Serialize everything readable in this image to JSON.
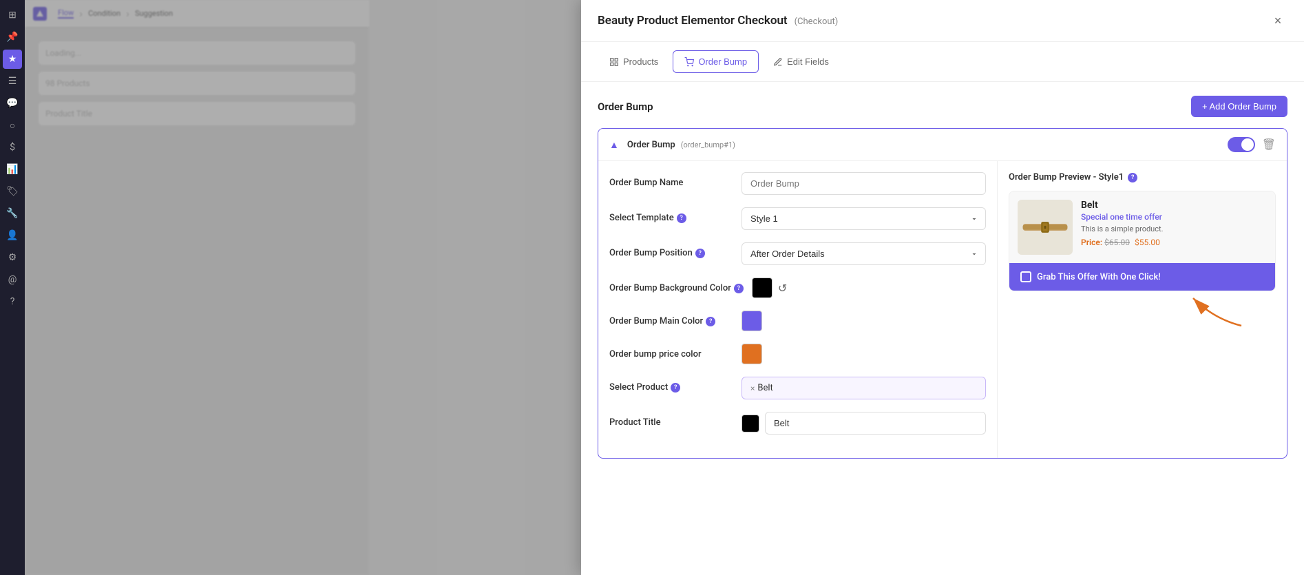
{
  "sidebar": {
    "icons": [
      "grid",
      "pin",
      "star",
      "list",
      "chat",
      "circle",
      "dollar",
      "chart",
      "tag",
      "wrench",
      "user",
      "settings",
      "at",
      "help"
    ]
  },
  "background": {
    "breadcrumbs": [
      "Flow",
      "Condition",
      "Suggestion"
    ],
    "active_crumb": "Flow"
  },
  "modal": {
    "title": "Beauty Product Elementor Checkout",
    "subtitle": "(Checkout)",
    "close_label": "×",
    "tabs": [
      {
        "id": "products",
        "label": "Products",
        "icon": "grid"
      },
      {
        "id": "order_bump",
        "label": "Order Bump",
        "icon": "cart",
        "active": true
      },
      {
        "id": "edit_fields",
        "label": "Edit Fields",
        "icon": "pencil"
      }
    ],
    "section": {
      "title": "Order Bump",
      "add_button": "+ Add Order Bump"
    },
    "order_bump": {
      "title": "Order Bump",
      "badge": "(order_bump#1)",
      "toggle_on": true,
      "fields": {
        "name_label": "Order Bump Name",
        "name_placeholder": "Order Bump",
        "template_label": "Select Template",
        "template_help": true,
        "template_value": "Style 1",
        "position_label": "Order Bump Position",
        "position_help": true,
        "position_value": "After Order Details",
        "bg_color_label": "Order Bump Background Color",
        "bg_color_help": true,
        "bg_color": "black",
        "main_color_label": "Order Bump Main Color",
        "main_color_help": true,
        "main_color": "purple",
        "price_color_label": "Order bump price color",
        "price_color": "orange",
        "product_label": "Select Product",
        "product_help": true,
        "product_selected": "Belt",
        "product_title_label": "Product Title",
        "product_title_color": "black",
        "product_title_value": "Belt"
      },
      "preview": {
        "header": "Order Bump Preview - Style1",
        "product_name": "Belt",
        "offer_text": "Special one time offer",
        "description": "This is a simple product.",
        "price_old": "$65.00",
        "price_new": "$55.00",
        "cta_text": "Grab This Offer With One Click!"
      }
    }
  }
}
